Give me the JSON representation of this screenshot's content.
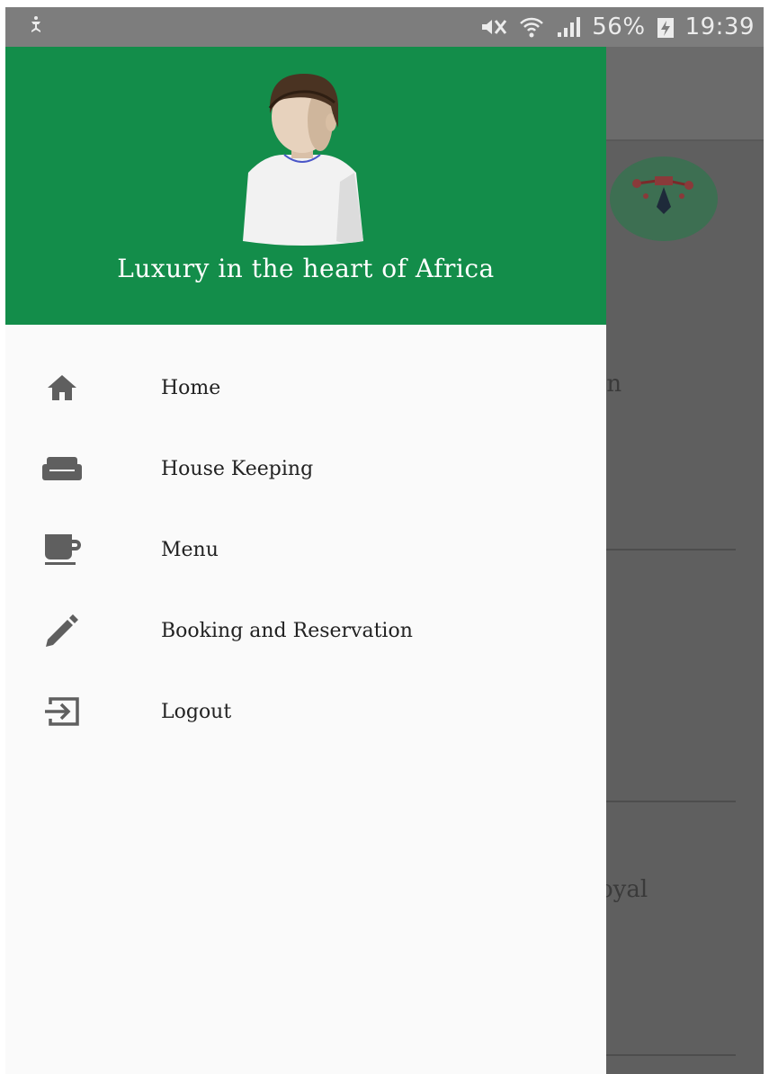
{
  "status_bar": {
    "battery": "56%",
    "time": "19:39"
  },
  "background_app": {
    "fragment_1": "in",
    "fragment_2": "oyal"
  },
  "drawer": {
    "header": {
      "tagline": "Luxury in the heart of Africa",
      "background_color": "#138d4a"
    },
    "items": [
      {
        "label": "Home",
        "icon": "home-icon"
      },
      {
        "label": "House Keeping",
        "icon": "sofa-icon"
      },
      {
        "label": "Menu",
        "icon": "coffee-cup-icon"
      },
      {
        "label": "Booking and Reservation",
        "icon": "pencil-icon"
      },
      {
        "label": "Logout",
        "icon": "logout-icon"
      }
    ]
  }
}
